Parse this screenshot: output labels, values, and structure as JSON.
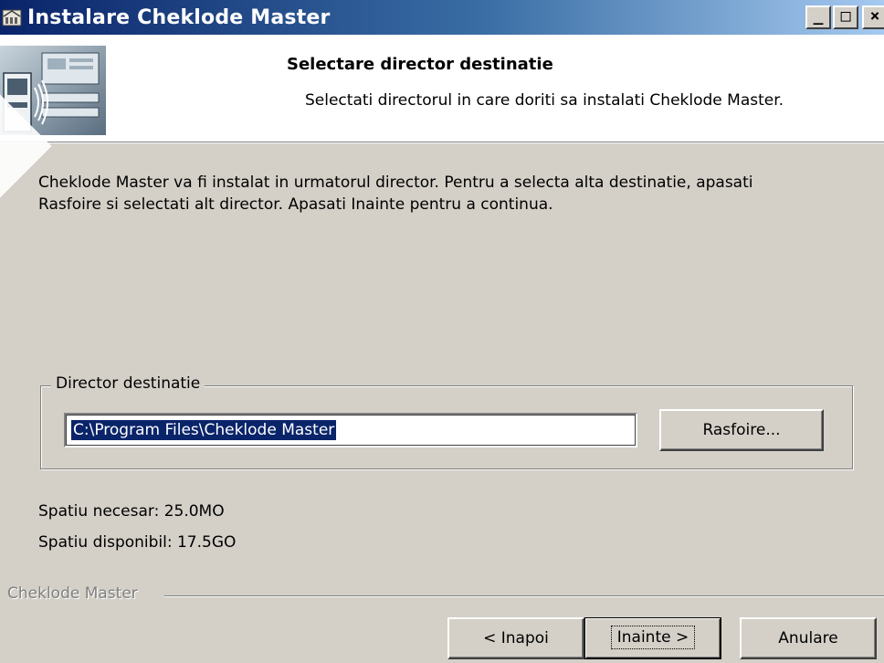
{
  "window": {
    "title": "Instalare Cheklode Master",
    "minimize_glyph": "_",
    "maximize_glyph": "□",
    "close_glyph": "×",
    "icon": "installer-app-icon"
  },
  "header": {
    "title": "Selectare director destinatie",
    "subtitle": "Selectati directorul in care doriti sa instalati Cheklode Master.",
    "image": "header-banner-icon"
  },
  "body": {
    "intro_line1": "Cheklode Master va fi instalat in urmatorul director. Pentru a selecta alta destinatie, apasati",
    "intro_line2": "Rasfoire si selectati alt director. Apasati Inainte pentru a continua.",
    "group_label": "Director destinatie",
    "path_value": "C:\\Program Files\\Cheklode Master",
    "browse_label": "Rasfoire...",
    "space_required": "Spatiu necesar: 25.0MO",
    "space_available": "Spatiu disponibil: 17.5GO"
  },
  "footer": {
    "brand": "Cheklode Master",
    "back_label": "< Inapoi",
    "next_label": "Inainte >",
    "cancel_label": "Anulare"
  },
  "colors": {
    "titlebar_start": "#0a246a",
    "titlebar_end": "#a6caf0",
    "dialog_bg": "#d4d0c8",
    "selection_bg": "#0a246a"
  }
}
